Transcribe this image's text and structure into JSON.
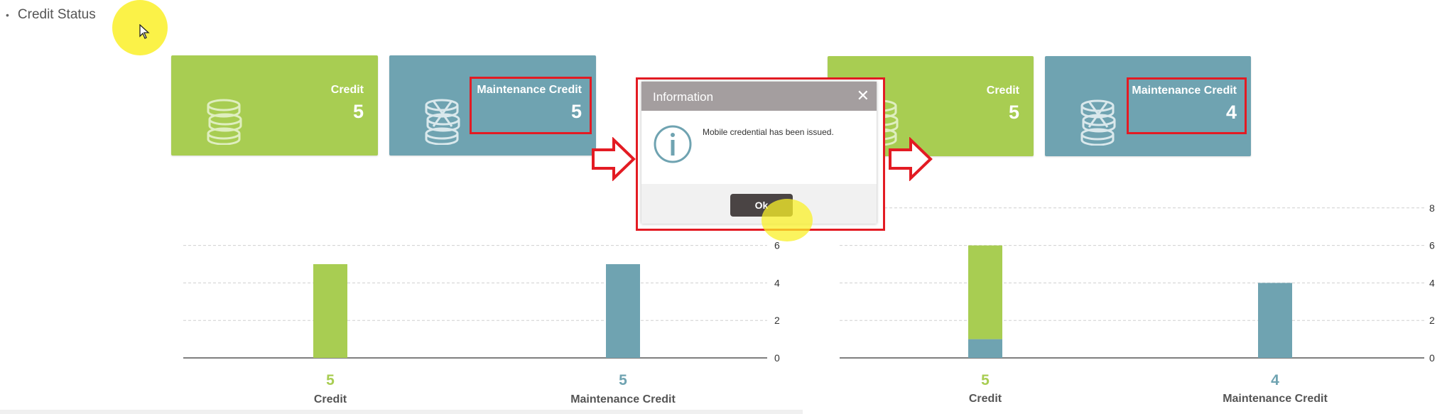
{
  "page": {
    "heading": "Credit Status",
    "bullet": "•"
  },
  "before": {
    "credit_label": "Credit",
    "credit_value": "5",
    "maint_label": "Maintenance Credit",
    "maint_value": "5",
    "chart_ticks": [
      "0",
      "2",
      "4",
      "6"
    ],
    "credit_val_text": "5",
    "maint_val_text": "5",
    "cat_credit": "Credit",
    "cat_maint": "Maintenance Credit"
  },
  "after": {
    "credit_label": "Credit",
    "credit_value": "5",
    "maint_label": "Maintenance Credit",
    "maint_value": "4",
    "chart_ticks": [
      "0",
      "2",
      "4",
      "6",
      "8"
    ],
    "credit_val_text": "5",
    "maint_val_text": "4",
    "cat_credit": "Credit",
    "cat_maint": "Maintenance Credit"
  },
  "dialog": {
    "title": "Information",
    "close": "✕",
    "message": "Mobile credential has been issued.",
    "ok": "Ok"
  },
  "colors": {
    "green": "#a8cd52",
    "teal": "#6fa3b1",
    "red_outline": "#e31b23",
    "highlight": "#f8ee2a"
  },
  "icons": [
    "coins-stack-icon",
    "coins-cross-icon",
    "info-icon",
    "close-icon",
    "arrow-right-icon",
    "cursor-icon"
  ],
  "chart_data": [
    {
      "type": "bar",
      "categories": [
        "Credit",
        "Maintenance Credit"
      ],
      "values": [
        5,
        5
      ],
      "ylim": [
        0,
        6
      ],
      "yticks": [
        0,
        2,
        4,
        6
      ],
      "grid": true
    },
    {
      "type": "bar",
      "categories": [
        "Credit",
        "Maintenance Credit"
      ],
      "series": [
        {
          "values": [
            5,
            0
          ]
        },
        {
          "values": [
            1,
            4
          ]
        }
      ],
      "ylim": [
        0,
        8
      ],
      "yticks": [
        0,
        2,
        4,
        6,
        8
      ],
      "grid": true
    }
  ]
}
